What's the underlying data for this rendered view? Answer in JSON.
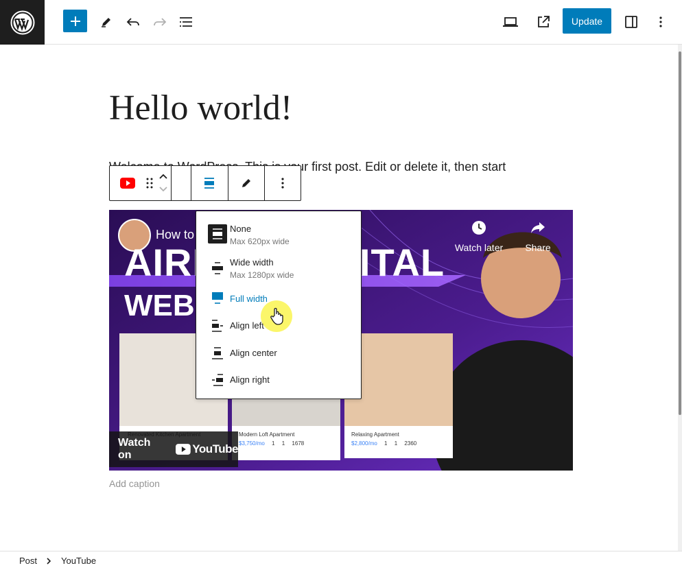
{
  "toolbar": {
    "add_label": "Add block",
    "update_label": "Update"
  },
  "post": {
    "title": "Hello world!",
    "paragraph": "Welcome to WordPress. This is your first post. Edit or delete it, then start",
    "caption_placeholder": "Add caption"
  },
  "embed": {
    "video_title": "How to Build a Website Like A...",
    "watch_later": "Watch later",
    "share": "Share",
    "big_text_1": "AIRBNB DIGITAL",
    "big_text_2": "WEBS",
    "watch_on": "Watch on",
    "youtube": "YouTube",
    "cards": [
      {
        "name": "Renovated Kitchen Apartment",
        "price": "",
        "beds": "",
        "baths": "",
        "sqft": ""
      },
      {
        "name": "Modern Loft Apartment",
        "price": "$3,750/mo",
        "beds": "1",
        "baths": "1",
        "sqft": "1678"
      },
      {
        "name": "Relaxing Apartment",
        "price": "$2,800/mo",
        "beds": "1",
        "baths": "1",
        "sqft": "2360"
      }
    ]
  },
  "align_menu": {
    "items": [
      {
        "label": "None",
        "sub": "Max 620px wide"
      },
      {
        "label": "Wide width",
        "sub": "Max 1280px wide"
      },
      {
        "label": "Full width",
        "sub": ""
      },
      {
        "label": "Align left",
        "sub": ""
      },
      {
        "label": "Align center",
        "sub": ""
      },
      {
        "label": "Align right",
        "sub": ""
      }
    ],
    "active_color": "#007cba"
  },
  "breadcrumb": {
    "root": "Post",
    "current": "YouTube"
  },
  "colors": {
    "accent": "#007cba",
    "dark": "#1e1e1e",
    "youtube_red": "#ff0000"
  }
}
